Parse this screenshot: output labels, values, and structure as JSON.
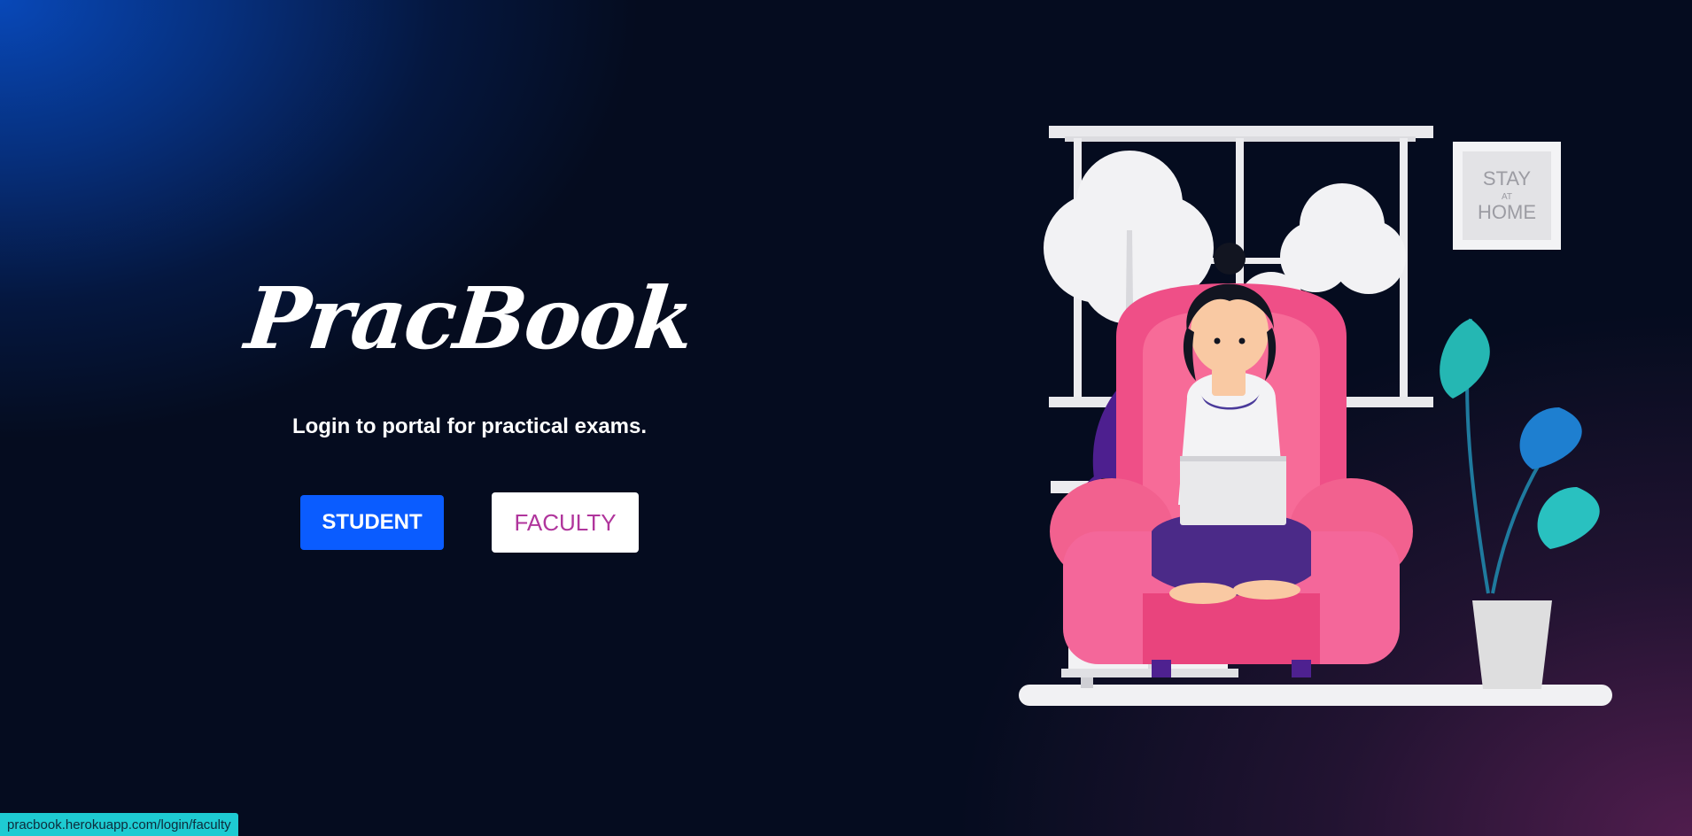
{
  "brand": {
    "name": "PracBook"
  },
  "hero": {
    "tagline": "Login to portal for practical exams."
  },
  "buttons": {
    "student_label": "STUDENT",
    "faculty_label": "FACULTY"
  },
  "illustration": {
    "frame_line1": "STAY",
    "frame_line2": "AT",
    "frame_line3": "HOME",
    "icon": "person-with-laptop-illustration"
  },
  "status_bar": {
    "url": "pracbook.herokuapp.com/login/faculty"
  },
  "colors": {
    "accent_blue": "#0a5cff",
    "faculty_text": "#b0359c",
    "status_bar_bg": "#1ecbd2",
    "background_dark": "#050c1f"
  }
}
